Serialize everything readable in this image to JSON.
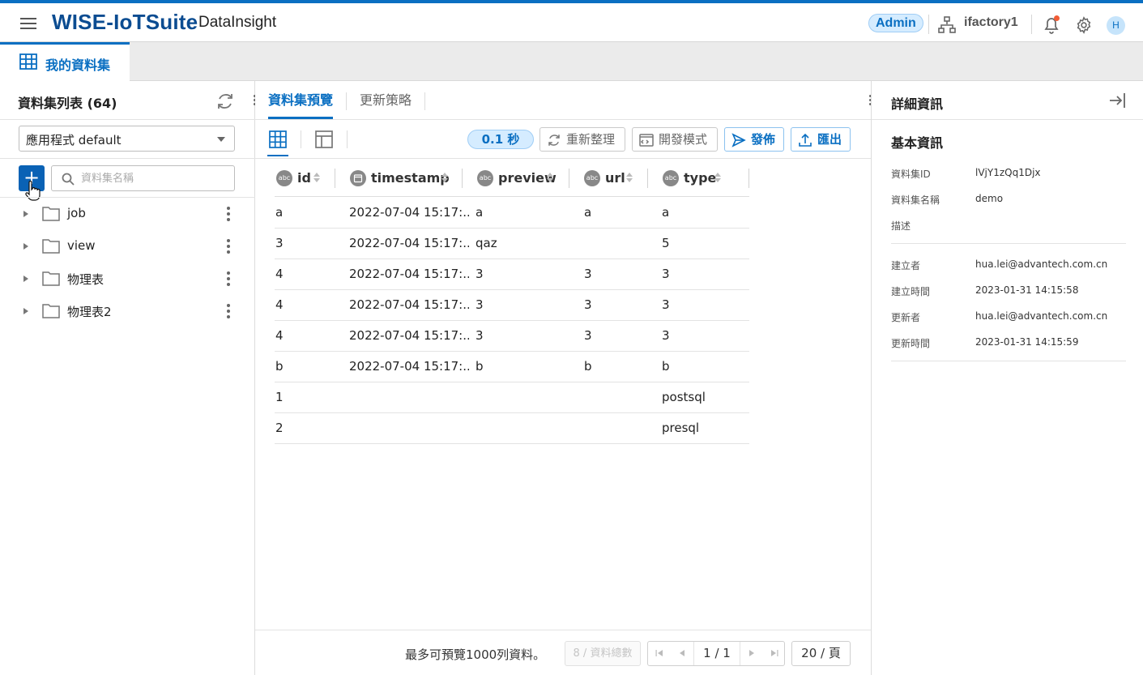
{
  "header": {
    "brand": "WISE-IoTSuite",
    "product": "DataInsight",
    "role": "Admin",
    "org": "ifactory1",
    "avatar_initial": "H"
  },
  "main_tab": {
    "label": "我的資料集",
    "icon": "table-icon"
  },
  "left_panel": {
    "title": "資料集列表 (64)",
    "app_select": "應用程式 default",
    "search_placeholder": "資料集名稱",
    "add_label": "+",
    "items": [
      {
        "label": "job"
      },
      {
        "label": "view"
      },
      {
        "label": "物理表"
      },
      {
        "label": "物理表2"
      }
    ]
  },
  "center": {
    "tabs": [
      {
        "label": "資料集預覽",
        "active": true
      },
      {
        "label": "更新策略",
        "active": false
      }
    ],
    "query_time": "0.1 秒",
    "buttons": {
      "refresh": "重新整理",
      "dev_mode": "開發模式",
      "publish": "發佈",
      "export": "匯出"
    },
    "table": {
      "type_badge": "abc",
      "columns": [
        {
          "label": "id",
          "type": "abc"
        },
        {
          "label": "timestamp",
          "type": "date"
        },
        {
          "label": "preview",
          "type": "abc"
        },
        {
          "label": "url",
          "type": "abc"
        },
        {
          "label": "type",
          "type": "abc"
        }
      ],
      "rows": [
        [
          "a",
          "2022-07-04 15:17:...",
          "a",
          "a",
          "a"
        ],
        [
          "3",
          "2022-07-04 15:17:...",
          "qaz",
          "",
          "5"
        ],
        [
          "4",
          "2022-07-04 15:17:...",
          "3",
          "3",
          "3"
        ],
        [
          "4",
          "2022-07-04 15:17:...",
          "3",
          "3",
          "3"
        ],
        [
          "4",
          "2022-07-04 15:17:...",
          "3",
          "3",
          "3"
        ],
        [
          "b",
          "2022-07-04 15:17:...",
          "b",
          "b",
          "b"
        ],
        [
          "1",
          "",
          "",
          "",
          "postsql"
        ],
        [
          "2",
          "",
          "",
          "",
          "presql"
        ]
      ]
    },
    "footer": {
      "note": "最多可預覽1000列資料。",
      "total": "8 / 資料總數",
      "page": "1 / 1",
      "page_size": "20 / 頁"
    }
  },
  "right_panel": {
    "title": "詳細資訊",
    "section": "基本資訊",
    "fields": [
      {
        "key": "資料集ID",
        "value": "lVjY1zQq1Djx"
      },
      {
        "key": "資料集名稱",
        "value": "demo"
      },
      {
        "key": "描述",
        "value": ""
      },
      {
        "key": "建立者",
        "value": "hua.lei@advantech.com.cn"
      },
      {
        "key": "建立時間",
        "value": "2023-01-31 14:15:58"
      },
      {
        "key": "更新者",
        "value": "hua.lei@advantech.com.cn"
      },
      {
        "key": "更新時間",
        "value": "2023-01-31 14:15:59"
      }
    ]
  },
  "colors": {
    "accent": "#0a6fc2",
    "brand": "#0b4c91",
    "badge_bg": "#d5ecff",
    "notify_dot": "#f25c35"
  }
}
